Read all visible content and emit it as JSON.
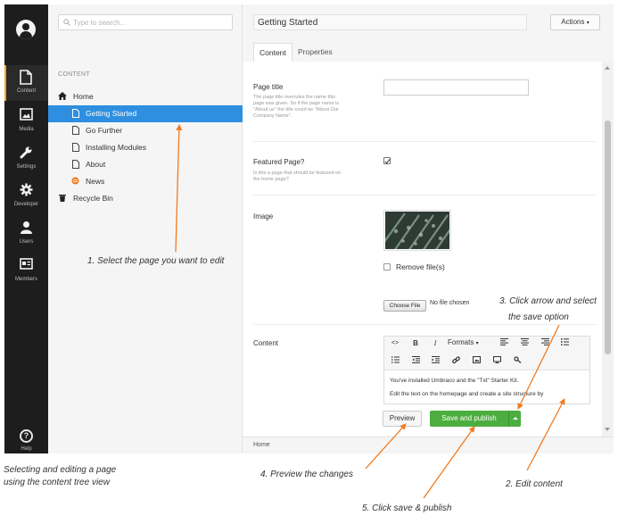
{
  "nav": {
    "items": [
      {
        "label": "Content",
        "icon": "document-icon",
        "active": true
      },
      {
        "label": "Media",
        "icon": "image-icon",
        "active": false
      },
      {
        "label": "Settings",
        "icon": "wrench-icon",
        "active": false
      },
      {
        "label": "Developer",
        "icon": "gear-icon",
        "active": false
      },
      {
        "label": "Users",
        "icon": "user-icon",
        "active": false
      },
      {
        "label": "Members",
        "icon": "id-card-icon",
        "active": false
      }
    ],
    "help_label": "Help",
    "accent_color": "#f5a623"
  },
  "tree": {
    "search_placeholder": "Type to search...",
    "section": "CONTENT",
    "items": [
      {
        "label": "Home",
        "icon": "home-icon"
      },
      {
        "label": "Getting Started",
        "icon": "document-icon",
        "selected": true
      },
      {
        "label": "Go Further",
        "icon": "document-icon"
      },
      {
        "label": "Installing Modules",
        "icon": "document-icon"
      },
      {
        "label": "About",
        "icon": "document-icon"
      },
      {
        "label": "News",
        "icon": "news-icon"
      },
      {
        "label": "Recycle Bin",
        "icon": "trash-icon"
      }
    ],
    "selected_color": "#2e8fe0"
  },
  "editor": {
    "page_name": "Getting Started",
    "actions_label": "Actions",
    "tabs": [
      "Content",
      "Properties"
    ],
    "page_title": {
      "label": "Page title",
      "description": "The page title overrules the name this page was given. So if the page name is \"About us\" the title could be \"About Our Company Name\".",
      "value": ""
    },
    "featured": {
      "label": "Featured Page?",
      "description": "Is this a page that should be featured on the home page?",
      "checked": true
    },
    "image": {
      "label": "Image",
      "remove_label": "Remove file(s)",
      "choose_file": "Choose File",
      "no_file": "No file chosen"
    },
    "content": {
      "label": "Content",
      "formats": "Formats",
      "line1": "You've installed Umbraco and the \"Txt\" Starter Kit.",
      "line2": "Edit the text on the homepage and create a site structure by"
    },
    "preview_label": "Preview",
    "save_publish_label": "Save and publish",
    "save_color": "#4cae3f",
    "breadcrumb": "Home"
  },
  "annotations": {
    "a1": "1. Select the page you want to edit",
    "a2": "2. Edit content",
    "a3_line1": "3. Click arrow and select",
    "a3_line2": "the save option",
    "a4": "4. Preview the changes",
    "a5": "5. Click save & publish",
    "caption_line1": "Selecting and editing a page",
    "caption_line2": "using the content tree view",
    "arrow_color": "#f07a1f"
  }
}
